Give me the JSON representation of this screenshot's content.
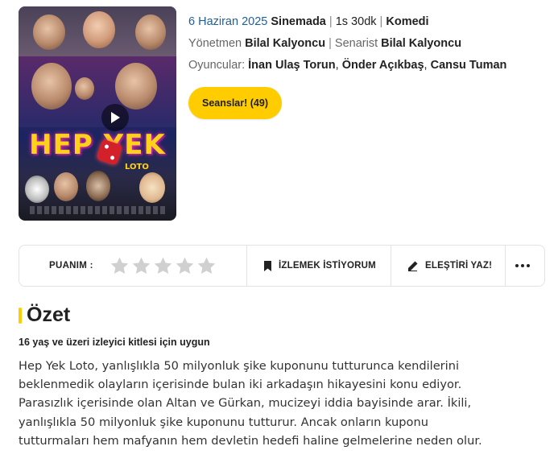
{
  "movie": {
    "date": "6 Haziran 2025",
    "release_type": "Sinemada",
    "duration": "1s 30dk",
    "genre": "Komedi",
    "director_label": "Yönetmen",
    "director": "Bilal Kalyoncu",
    "writer_label": "Senarist",
    "writer": "Bilal Kalyoncu",
    "cast_label": "Oyuncular:",
    "cast": [
      "İnan Ulaş Torun",
      "Önder Açıkbaş",
      "Cansu Tuman"
    ],
    "poster_title": "HEP YEK",
    "poster_subtitle": "LOTO"
  },
  "buttons": {
    "seanslar": "Seanslar! (49)"
  },
  "actionbar": {
    "rating_label": "PUANIM :",
    "rating_stars": 0,
    "rating_max": 5,
    "watchlist_label": "İZLEMEK İSTİYORUM",
    "review_label": "ELEŞTİRİ YAZ!"
  },
  "summary": {
    "heading": "Özet",
    "age_rating": "16 yaş ve üzeri izleyici kitlesi için uygun",
    "lines": [
      "Hep Yek Loto,  yanlışlıkla 50 milyonluk şike kuponunu tutturunca kendilerini",
      "beklenmedik olayların içerisinde bulan iki arkadaşın hikayesini konu ediyor.",
      "Parasızlık içerisinde olan Altan ve Gürkan, mucizeyi iddia bayisinde arar. İkili,",
      "yanlışlıkla 50 milyonluk şike kuponunu tutturur. Ancak onların kuponu",
      "tutturmaları hem mafyanın hem devletin hedefi haline gelmelerine neden olur."
    ]
  },
  "colors": {
    "accent": "#ffcc00",
    "link_blue": "#1f5f95",
    "star_empty": "#d0d0d0"
  },
  "icons": {
    "play": "play-icon",
    "bookmark": "bookmark-icon",
    "pencil": "pencil-icon",
    "more": "more-dots-icon",
    "star": "star-icon"
  }
}
